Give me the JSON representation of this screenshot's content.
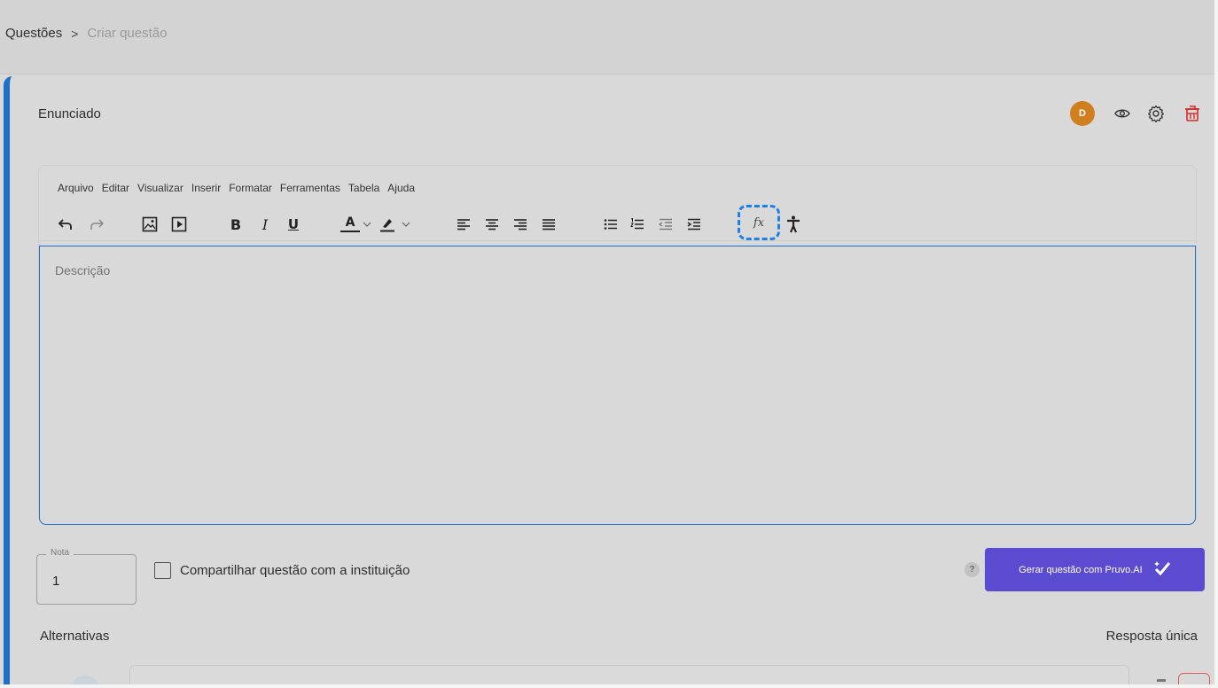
{
  "breadcrumb": {
    "parent": "Questões",
    "separator": ">",
    "current": "Criar questão"
  },
  "statement": {
    "title": "Enunciado",
    "avatar_initial": "D",
    "icons": [
      "eye-icon",
      "gear-icon",
      "trash-icon"
    ],
    "colors": {
      "avatar": "#d17f1e",
      "trash": "#d62c2c",
      "accent_border": "#1e6fc8"
    }
  },
  "editor": {
    "menu": [
      "Arquivo",
      "Editar",
      "Visualizar",
      "Inserir",
      "Formatar",
      "Ferramentas",
      "Tabela",
      "Ajuda"
    ],
    "toolbar": {
      "bold": "B",
      "italic": "I",
      "underline": "U",
      "text_color": "A",
      "formula": "fx",
      "buttons": [
        "undo-icon",
        "redo-icon",
        "insert-image-icon",
        "insert-media-icon",
        "bold-icon",
        "italic-icon",
        "underline-icon",
        "text-color-icon",
        "highlight-color-icon",
        "align-left-icon",
        "align-center-icon",
        "align-right-icon",
        "align-justify-icon",
        "bullet-list-icon",
        "numbered-list-icon",
        "outdent-icon",
        "indent-icon",
        "formula-icon",
        "accessibility-icon"
      ]
    },
    "placeholder": "Descrição"
  },
  "nota": {
    "label": "Nota",
    "value": "1"
  },
  "share": {
    "label": "Compartilhar questão com a instituição",
    "checked": false
  },
  "help": "?",
  "ai_button": {
    "label": "Gerar questão com Pruvo.AI",
    "color": "#5b4bd0"
  },
  "alternatives": {
    "title": "Alternativas",
    "mode": "Resposta única"
  }
}
